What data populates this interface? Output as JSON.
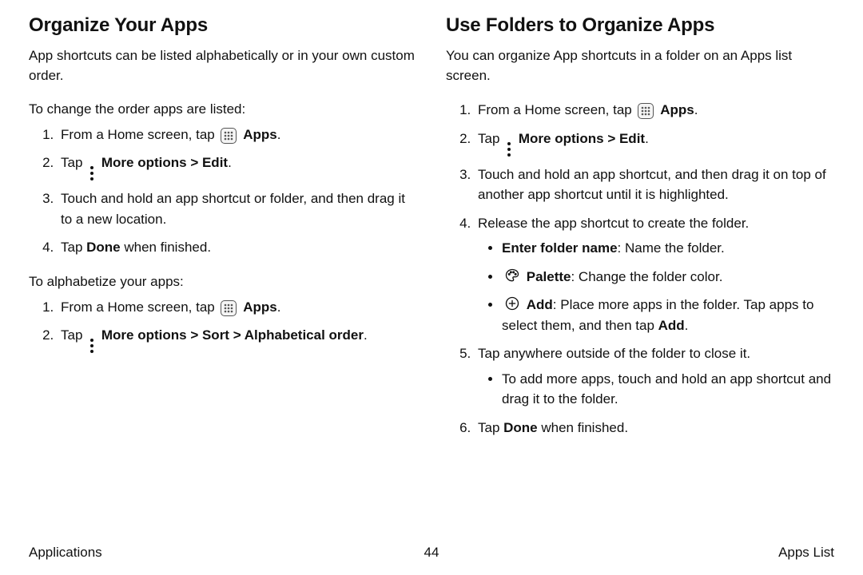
{
  "page": {
    "footer_left": "Applications",
    "footer_page": "44",
    "footer_right": "Apps List"
  },
  "icons": {
    "apps": "apps-grid",
    "more": "more-options",
    "palette": "palette",
    "add": "add"
  },
  "left": {
    "heading": "Organize Your Apps",
    "intro": "App shortcuts can be listed alphabetically or in your own custom order.",
    "sec1_lead": "To change the order apps are listed:",
    "sec1": {
      "s1_pre": "From a Home screen, tap ",
      "s1_label": "Apps",
      "s1_post": ".",
      "s2_pre": "Tap ",
      "s2_b1": "More options",
      "s2_mid": " > ",
      "s2_b2": "Edit",
      "s2_post": ".",
      "s3": "Touch and hold an app shortcut or folder, and then drag it to a new location.",
      "s4_pre": "Tap ",
      "s4_b": "Done",
      "s4_post": " when finished."
    },
    "sec2_lead": "To alphabetize your apps:",
    "sec2": {
      "s1_pre": "From a Home screen, tap ",
      "s1_label": "Apps",
      "s1_post": ".",
      "s2_pre": "Tap ",
      "s2_b1": "More options",
      "s2_mid1": " > ",
      "s2_b2": "Sort",
      "s2_mid2": " > ",
      "s2_b3": "Alphabetical order",
      "s2_post": "."
    }
  },
  "right": {
    "heading": "Use Folders to Organize Apps",
    "intro": "You can organize App shortcuts in a folder on an Apps list screen.",
    "steps": {
      "s1_pre": "From a Home screen, tap ",
      "s1_label": "Apps",
      "s1_post": ".",
      "s2_pre": "Tap ",
      "s2_b1": "More options",
      "s2_mid": " > ",
      "s2_b2": "Edit",
      "s2_post": ".",
      "s3": "Touch and hold an app shortcut, and then drag it on top of another app shortcut until it is highlighted.",
      "s4": "Release the app shortcut to create the folder.",
      "s4_b1_label": "Enter folder name",
      "s4_b1_rest": ": Name the folder.",
      "s4_b2_label": "Palette",
      "s4_b2_rest": ": Change the folder color.",
      "s4_b3_label": "Add",
      "s4_b3_rest": ": Place more apps in the folder. Tap apps to select them, and then tap ",
      "s4_b3_b": "Add",
      "s4_b3_post": ".",
      "s5": "Tap anywhere outside of the folder to close it.",
      "s5_b1": "To add more apps, touch and hold an app shortcut and drag it to the folder.",
      "s6_pre": "Tap ",
      "s6_b": "Done",
      "s6_post": " when finished."
    }
  }
}
